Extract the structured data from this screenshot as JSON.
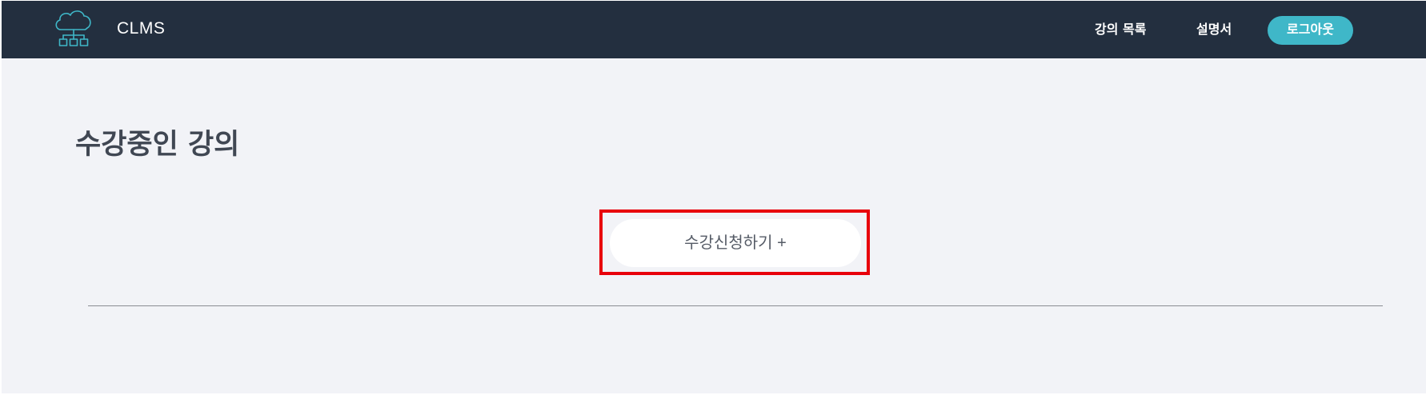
{
  "header": {
    "brand": "CLMS",
    "logo_icon": "cloud-network-icon",
    "nav": {
      "courses_label": "강의 목록",
      "manual_label": "설명서",
      "logout_label": "로그아웃"
    }
  },
  "main": {
    "title": "수강중인 강의",
    "enroll_button_label": "수강신청하기 +"
  },
  "colors": {
    "navbar_bg": "#232f3f",
    "page_bg": "#f2f3f7",
    "accent": "#3fb7c8",
    "highlight_border": "#e8000b",
    "title_text": "#404753"
  }
}
